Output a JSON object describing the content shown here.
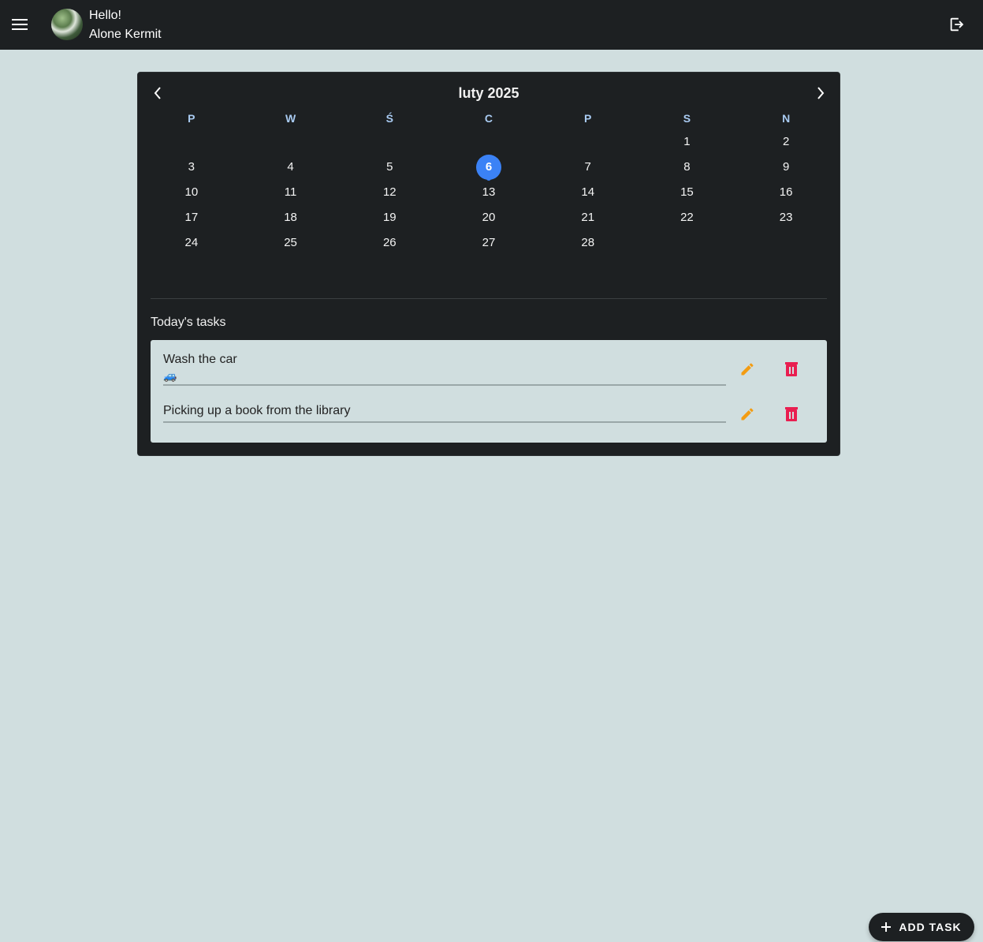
{
  "header": {
    "greeting": "Hello!",
    "user_name": "Alone Kermit",
    "menu_icon": "menu-icon",
    "logout_icon": "logout-icon"
  },
  "calendar": {
    "month_label": "luty 2025",
    "weekdays": [
      "P",
      "W",
      "Ś",
      "C",
      "P",
      "S",
      "N"
    ],
    "leading_blanks": 5,
    "days": [
      "1",
      "2",
      "3",
      "4",
      "5",
      "6",
      "7",
      "8",
      "9",
      "10",
      "11",
      "12",
      "13",
      "14",
      "15",
      "16",
      "17",
      "18",
      "19",
      "20",
      "21",
      "22",
      "23",
      "24",
      "25",
      "26",
      "27",
      "28"
    ],
    "today": "6",
    "accent_color": "#3b82f6"
  },
  "tasks": {
    "title": "Today's tasks",
    "items": [
      {
        "title": "Wash the car",
        "emoji": "🚙"
      },
      {
        "title": "Picking up a book from the library",
        "emoji": ""
      }
    ],
    "edit_color": "#f39c12",
    "delete_color": "#e91e50"
  },
  "fab": {
    "label": "ADD TASK",
    "icon": "plus-icon"
  }
}
